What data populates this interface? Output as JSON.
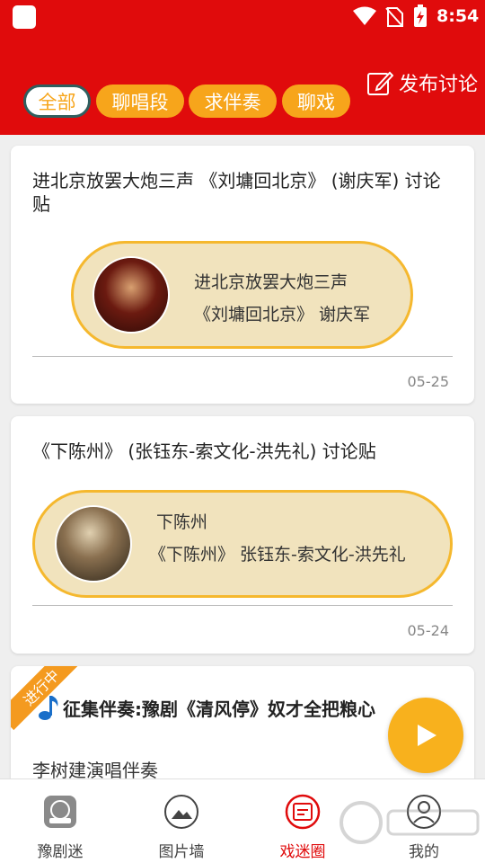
{
  "status_bar": {
    "time": "8:54"
  },
  "header": {
    "tabs": [
      {
        "label": "全部",
        "active": true
      },
      {
        "label": "聊唱段",
        "active": false
      },
      {
        "label": "求伴奏",
        "active": false
      },
      {
        "label": "聊戏",
        "active": false
      }
    ],
    "publish_label": "发布讨论"
  },
  "posts": [
    {
      "title": "进北京放罢大炮三声 《刘墉回北京》 (谢庆军) 讨论贴",
      "pill_line1": "进北京放罢大炮三声",
      "pill_line2": "《刘墉回北京》 谢庆军",
      "date": "05-25"
    },
    {
      "title": "《下陈州》 (张钰东-索文化-洪先礼) 讨论贴",
      "pill_line1": "下陈州",
      "pill_line2": "《下陈州》 张钰东-索文化-洪先礼",
      "date": "05-24"
    }
  ],
  "solicitation": {
    "badge": "进行中",
    "title": "征集伴奏:豫剧《清风停》奴才全把粮心",
    "subtitle": "李树建演唱伴奏"
  },
  "bottom_nav": [
    {
      "label": "豫剧迷",
      "active": false,
      "icon": "opera-logo-icon"
    },
    {
      "label": "图片墙",
      "active": false,
      "icon": "image-icon"
    },
    {
      "label": "戏迷圈",
      "active": true,
      "icon": "chat-circle-icon"
    },
    {
      "label": "我的",
      "active": false,
      "icon": "user-icon"
    }
  ],
  "colors": {
    "brand_red": "#e00b0c",
    "accent_orange": "#f7a51b",
    "pill_bg": "#f1e3bd"
  }
}
